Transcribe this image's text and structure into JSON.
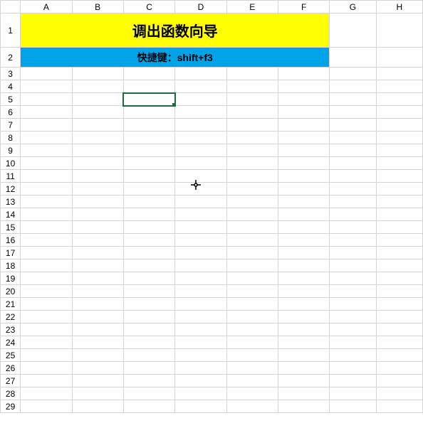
{
  "columns": [
    "A",
    "B",
    "C",
    "D",
    "E",
    "F",
    "G",
    "H"
  ],
  "rows": [
    "1",
    "2",
    "3",
    "4",
    "5",
    "6",
    "7",
    "8",
    "9",
    "10",
    "11",
    "12",
    "13",
    "14",
    "15",
    "16",
    "17",
    "18",
    "19",
    "20",
    "21",
    "22",
    "23",
    "24",
    "25",
    "26",
    "27",
    "28",
    "29"
  ],
  "cells": {
    "A1": "调出函数向导",
    "A2": "快捷键：shift+f3"
  },
  "selected_cell": "C5",
  "cursor_position": {
    "row": 11,
    "col_near": "D"
  },
  "chart_data": {
    "type": "table",
    "title": "调出函数向导",
    "note": "快捷键：shift+f3",
    "columns": [
      "A",
      "B",
      "C",
      "D",
      "E",
      "F",
      "G",
      "H"
    ],
    "rows_count": 29,
    "merged_regions": [
      {
        "range": "A1:F1",
        "value": "调出函数向导",
        "fill": "#ffff00"
      },
      {
        "range": "A2:F2",
        "value": "快捷键：shift+f3",
        "fill": "#00a2e8"
      }
    ],
    "selection": "C5"
  }
}
